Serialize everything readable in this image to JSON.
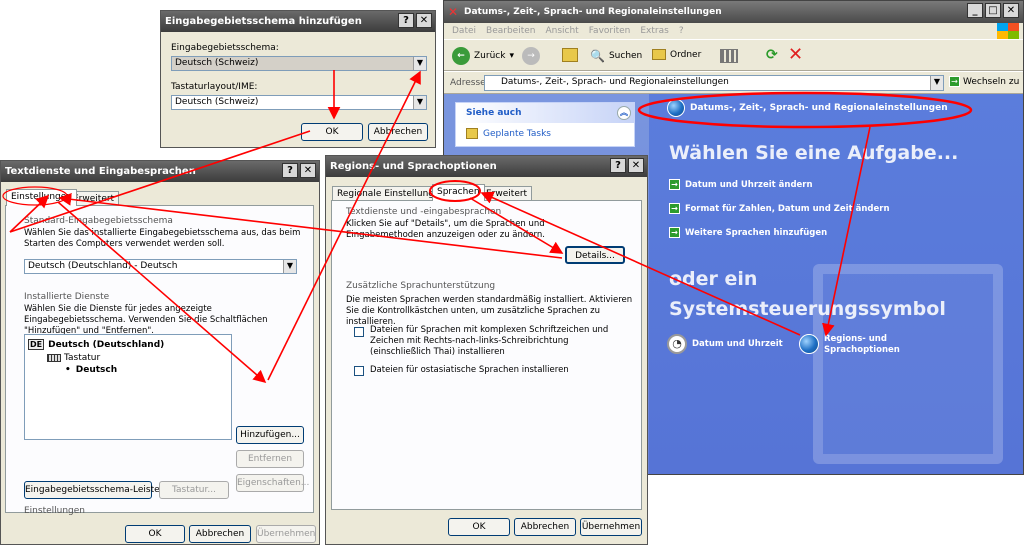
{
  "explorer": {
    "title": "Datums-, Zeit-, Sprach- und Regionaleinstellungen",
    "menu": [
      "Datei",
      "Bearbeiten",
      "Ansicht",
      "Favoriten",
      "Extras",
      "?"
    ],
    "toolbar": {
      "back": "Zurück",
      "search": "Suchen",
      "folders": "Ordner"
    },
    "address_label": "Adresse",
    "address_value": "Datums-, Zeit-, Sprach- und Regionaleinstellungen",
    "go_label": "Wechseln zu",
    "see_also_title": "Siehe auch",
    "see_also_item": "Geplante Tasks",
    "category_title": "Datums-, Zeit-, Sprach- und Regionaleinstellungen",
    "pick_task": "Wählen Sie eine Aufgabe...",
    "tasks": [
      "Datum und Uhrzeit ändern",
      "Format für Zahlen, Datum und Zeit ändern",
      "Weitere Sprachen hinzufügen"
    ],
    "or_pick_1": "oder ein",
    "or_pick_2": "Systemsteuerungssymbol",
    "icons": [
      {
        "label": "Datum und Uhrzeit"
      },
      {
        "label1": "Regions- und",
        "label2": "Sprachoptionen"
      }
    ]
  },
  "add_dialog": {
    "title": "Eingabegebietsschema hinzufügen",
    "schema_label": "Eingabegebietsschema:",
    "schema_value": "Deutsch (Schweiz)",
    "layout_label": "Tastaturlayout/IME:",
    "layout_value": "Deutsch (Schweiz)",
    "ok": "OK",
    "cancel": "Abbrechen"
  },
  "text_dialog": {
    "title": "Textdienste und Eingabesprachen",
    "tabs": [
      "Einstellungen",
      "Erweitert"
    ],
    "default_group": "Standard-Eingabegebietsschema",
    "default_desc": "Wählen Sie das installierte Eingabegebietsschema aus, das beim Starten des Computers verwendet werden soll.",
    "default_value": "Deutsch (Deutschland) - Deutsch",
    "installed_group": "Installierte Dienste",
    "installed_desc": "Wählen Sie die Dienste für jedes angezeigte Eingabegebietsschema. Verwenden Sie die Schaltflächen \"Hinzufügen\" und \"Entfernen\".",
    "tree_lang_code": "DE",
    "tree_lang": "Deutsch (Deutschland)",
    "tree_kbd": "Tastatur",
    "tree_item": "Deutsch",
    "add": "Hinzufügen...",
    "remove": "Entfernen",
    "props": "Eigenschaften...",
    "settings_group": "Einstellungen",
    "langbar": "Eingabegebietsschema-Leiste...",
    "keyboard": "Tastatur...",
    "ok": "OK",
    "cancel": "Abbrechen",
    "apply": "Übernehmen"
  },
  "region_dialog": {
    "title": "Regions- und Sprachoptionen",
    "tabs": [
      "Regionale Einstellungen",
      "Sprachen",
      "Erweitert"
    ],
    "text_group": "Textdienste und -eingabesprachen",
    "text_desc": "Klicken Sie auf \"Details\", um die Sprachen und Eingabemethoden anzuzeigen oder zu ändern.",
    "details": "Details...",
    "extra_group": "Zusätzliche Sprachunterstützung",
    "extra_desc": "Die meisten Sprachen werden standardmäßig installiert. Aktivieren Sie die Kontrollkästchen unten, um zusätzliche Sprachen zu installieren.",
    "chk1": "Dateien für Sprachen mit komplexen Schriftzeichen und Zeichen mit Rechts-nach-links-Schreibrichtung (einschließlich Thai) installieren",
    "chk2": "Dateien für ostasiatische Sprachen installieren",
    "ok": "OK",
    "cancel": "Abbrechen",
    "apply": "Übernehmen"
  },
  "colors": {
    "annotation": "#ff0000",
    "xp_blue": "#5a7edc",
    "task_blue": "#6e8fdc"
  }
}
